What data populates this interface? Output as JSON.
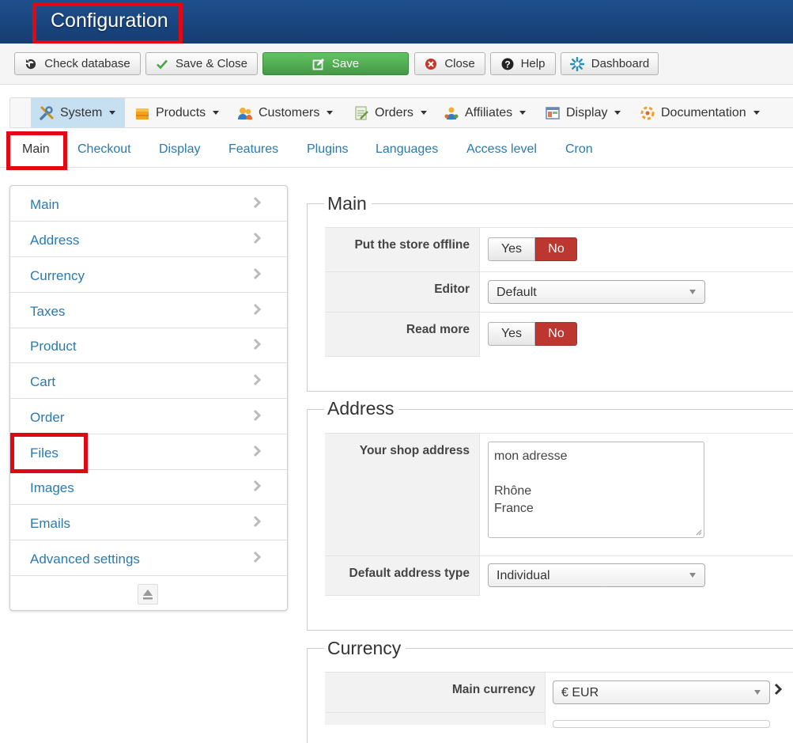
{
  "app": {
    "title": "Configuration"
  },
  "toolbar": {
    "check_database": "Check database",
    "save_close": "Save & Close",
    "save": "Save",
    "close": "Close",
    "help": "Help",
    "dashboard": "Dashboard"
  },
  "menu": {
    "items": [
      {
        "label": "System",
        "icon": "tools-icon"
      },
      {
        "label": "Products",
        "icon": "products-box-icon"
      },
      {
        "label": "Customers",
        "icon": "customers-icon"
      },
      {
        "label": "Orders",
        "icon": "orders-icon"
      },
      {
        "label": "Affiliates",
        "icon": "affiliates-icon"
      },
      {
        "label": "Display",
        "icon": "display-icon"
      },
      {
        "label": "Documentation",
        "icon": "documentation-icon"
      }
    ]
  },
  "tabs": [
    "Main",
    "Checkout",
    "Display",
    "Features",
    "Plugins",
    "Languages",
    "Access level",
    "Cron"
  ],
  "sidebar": {
    "items": [
      "Main",
      "Address",
      "Currency",
      "Taxes",
      "Product",
      "Cart",
      "Order",
      "Files",
      "Images",
      "Emails",
      "Advanced settings"
    ]
  },
  "main_section": {
    "legend": "Main",
    "store_offline_label": "Put the store offline",
    "editor_label": "Editor",
    "editor_value": "Default",
    "read_more_label": "Read more",
    "yes": "Yes",
    "no": "No"
  },
  "address_section": {
    "legend": "Address",
    "shop_address_label": "Your shop address",
    "shop_address_lines": [
      "mon adresse",
      "",
      "Rhône",
      "France"
    ],
    "default_type_label": "Default address type",
    "default_type_value": "Individual"
  },
  "currency_section": {
    "legend": "Currency",
    "main_currency_label": "Main currency",
    "main_currency_value": "€ EUR"
  },
  "colors": {
    "header": "#1f4f8c",
    "link": "#2a7ab0",
    "save_green": "#5bb75b",
    "no_red": "#bd362f",
    "highlight": "#e30613"
  }
}
